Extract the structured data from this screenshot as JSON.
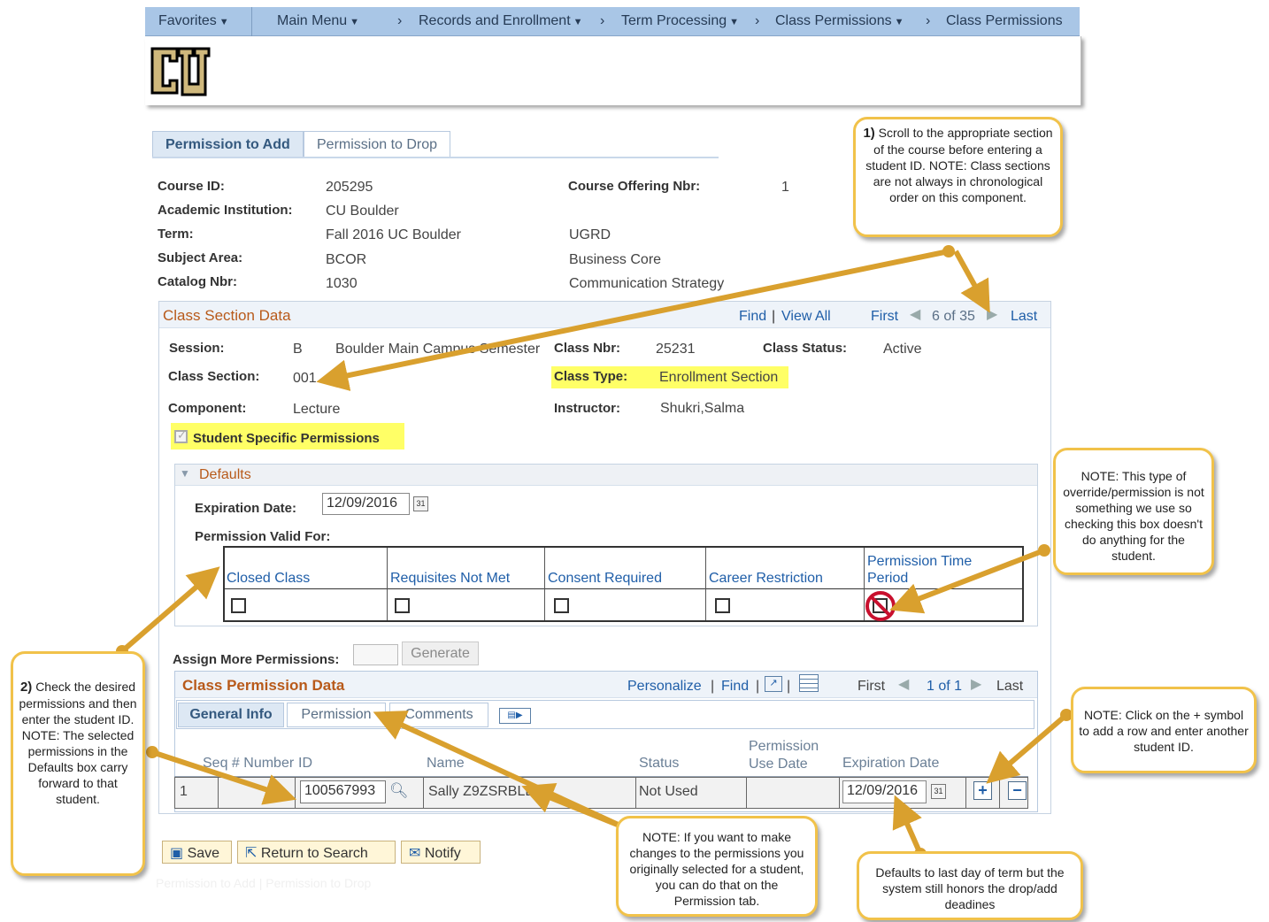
{
  "topnav": {
    "favorites": "Favorites",
    "main_menu": "Main Menu",
    "crumb_records": "Records and Enrollment",
    "crumb_term": "Term Processing",
    "crumb_perm_menu": "Class Permissions",
    "crumb_perm": "Class Permissions"
  },
  "tabs": {
    "add": "Permission to Add",
    "drop": "Permission to Drop"
  },
  "course": {
    "course_id_label": "Course ID:",
    "course_id": "205295",
    "inst_label": "Academic Institution:",
    "inst": "CU Boulder",
    "term_label": "Term:",
    "term": "Fall 2016 UC Boulder",
    "career": "UGRD",
    "subject_label": "Subject Area:",
    "subject": "BCOR",
    "subject_desc": "Business Core",
    "catalog_label": "Catalog Nbr:",
    "catalog": "1030",
    "catalog_desc": "Communication Strategy",
    "offering_label": "Course Offering Nbr:",
    "offering": "1"
  },
  "class_section": {
    "title": "Class Section Data",
    "find": "Find",
    "view_all": "View All",
    "first": "First",
    "position": "6 of 35",
    "last": "Last",
    "session_label": "Session:",
    "session": "B",
    "session_desc": "Boulder Main Campus Semester",
    "class_nbr_label": "Class Nbr:",
    "class_nbr": "25231",
    "status_label": "Class Status:",
    "status": "Active",
    "section_label": "Class Section:",
    "section": "001",
    "type_label": "Class Type:",
    "type": "Enrollment Section",
    "component_label": "Component:",
    "component": "Lecture",
    "instructor_label": "Instructor:",
    "instructor": "Shukri,Salma",
    "student_specific": "Student Specific Permissions"
  },
  "defaults": {
    "title": "Defaults",
    "exp_label": "Expiration Date:",
    "exp_date": "12/09/2016",
    "valid_for": "Permission Valid For:",
    "columns": [
      "Closed Class",
      "Requisites Not Met",
      "Consent Required",
      "Career Restriction",
      "Permission Time Period"
    ]
  },
  "assign": {
    "label": "Assign More Permissions:",
    "generate": "Generate"
  },
  "class_perm": {
    "title": "Class Permission Data",
    "personalize": "Personalize",
    "find": "Find",
    "first": "First",
    "position": "1 of 1",
    "last": "Last",
    "subtabs": [
      "General Info",
      "Permission",
      "Comments"
    ],
    "columns": [
      "Seq # Number",
      "ID",
      "Name",
      "Status",
      "Permission Use Date",
      "Expiration Date"
    ],
    "row": {
      "seq": "1",
      "id": "100567993",
      "name": "Sally Z9ZSRBLD01",
      "status": "Not Used",
      "use_date": "",
      "exp": "12/09/2016"
    }
  },
  "buttons": {
    "save": "Save",
    "return": "Return to Search",
    "notify": "Notify"
  },
  "footer_links": "Permission to Add | Permission to Drop",
  "callouts": {
    "c1_num": "1)",
    "c1": "Scroll to the appropriate section of the course before entering a student ID. NOTE: Class sections are not always in chronological order on this component.",
    "c2_num": "2)",
    "c2": "Check the desired permissions and then enter the student ID. NOTE: The selected permissions in the Defaults box carry forward to that student.",
    "c3": "NOTE: This type of override/permission is not something we use so checking this box doesn't do anything for the student.",
    "c4": "NOTE: Click on the + symbol to add a row and enter another student ID.",
    "c5": "NOTE: If you want to make changes to the permissions you originally selected for a student, you can do that on the Permission tab.",
    "c6": "Defaults to last day of term but the system still honors the drop/add deadines"
  },
  "colors": {
    "nav": "#a9c6e6",
    "section_title": "#b85a1a",
    "highlight": "#ffff66",
    "callout_border": "#f1c24a",
    "arrow": "#d9a02e"
  }
}
